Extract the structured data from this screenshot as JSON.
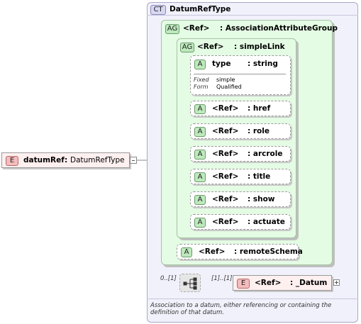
{
  "complex_type": {
    "badge": "CT",
    "name": "DatumRefType"
  },
  "root_element": {
    "badge": "E",
    "name": "datumRef",
    "separator": ":",
    "type": "DatumRefType"
  },
  "attribute_group_outer": {
    "badge": "AG",
    "ref": "<Ref>",
    "name": ": AssociationAttributeGroup"
  },
  "attribute_group_inner": {
    "badge": "AG",
    "ref": "<Ref>",
    "name": ": simpleLink"
  },
  "type_attribute": {
    "badge": "A",
    "name": "type",
    "type": ": string",
    "fixed_label": "Fixed",
    "fixed_value": "simple",
    "form_label": "Form",
    "form_value": "Qualified"
  },
  "ref_attributes": [
    {
      "badge": "A",
      "ref": "<Ref>",
      "name": ": href"
    },
    {
      "badge": "A",
      "ref": "<Ref>",
      "name": ": role"
    },
    {
      "badge": "A",
      "ref": "<Ref>",
      "name": ": arcrole"
    },
    {
      "badge": "A",
      "ref": "<Ref>",
      "name": ": title"
    },
    {
      "badge": "A",
      "ref": "<Ref>",
      "name": ": show"
    },
    {
      "badge": "A",
      "ref": "<Ref>",
      "name": ": actuate"
    }
  ],
  "remote_schema": {
    "badge": "A",
    "ref": "<Ref>",
    "name": ": remoteSchema"
  },
  "choice_occurrence": "0..[1]",
  "datum_occurrence": "[1]..[1]",
  "datum_element": {
    "badge": "E",
    "ref": "<Ref>",
    "name": ": _Datum"
  },
  "documentation": "Association to a datum, either referencing or containing the definition of that datum.",
  "icons": {
    "expand": "plus-icon",
    "collapse": "minus-icon",
    "compositor": "choice-compositor-icon"
  }
}
